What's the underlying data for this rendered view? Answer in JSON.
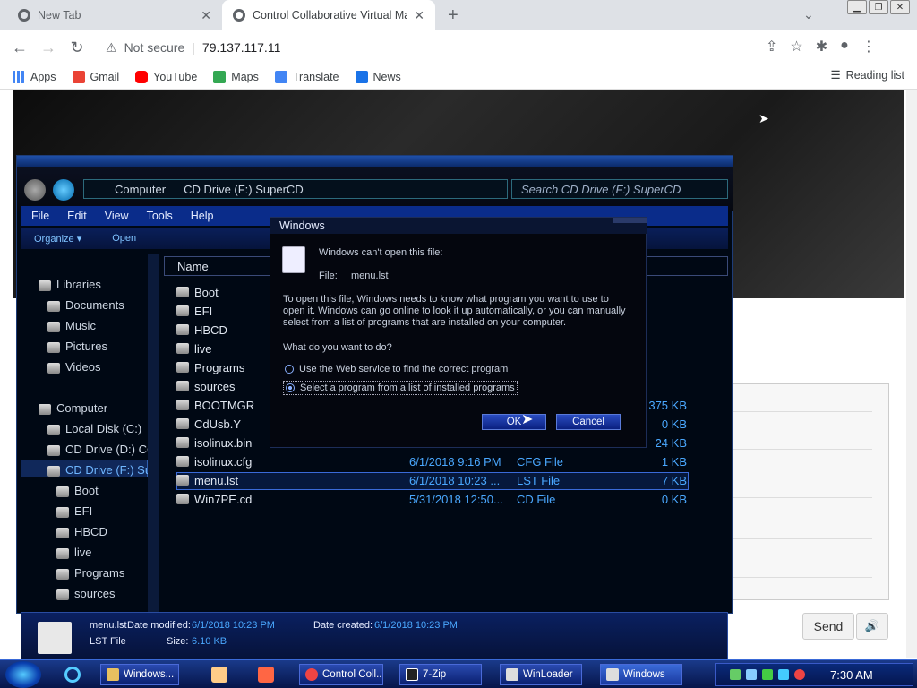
{
  "browser": {
    "tabs": [
      {
        "title": "New Tab",
        "active": false
      },
      {
        "title": "Control Collaborative Virtual Ma",
        "active": true
      }
    ],
    "address": {
      "security": "Not secure",
      "url": "79.137.117.11"
    },
    "bookmarks": [
      {
        "label": "Apps",
        "color": "#4285f4"
      },
      {
        "label": "Gmail",
        "color": "#ea4335"
      },
      {
        "label": "YouTube",
        "color": "#ff0000"
      },
      {
        "label": "Maps",
        "color": "#34a853"
      },
      {
        "label": "Translate",
        "color": "#4285f4"
      },
      {
        "label": "News",
        "color": "#1a73e8"
      }
    ],
    "reading_list": "Reading list"
  },
  "side_panel": {
    "send_label": "Send"
  },
  "explorer": {
    "address": {
      "part1": "Computer",
      "part2": "CD Drive (F:) SuperCD"
    },
    "search_placeholder": "Search CD Drive (F:) SuperCD",
    "menu": [
      "File",
      "Edit",
      "View",
      "Tools",
      "Help"
    ],
    "commands": {
      "organize": "Organize ▾",
      "open": "Open"
    },
    "nav": {
      "libraries": "Libraries",
      "lib_items": [
        "Documents",
        "Music",
        "Pictures",
        "Videos"
      ],
      "computer": "Computer",
      "drives": [
        "Local Disk (C:)",
        "CD Drive (D:) CC",
        "CD Drive (F:) Su"
      ],
      "folders": [
        "Boot",
        "EFI",
        "HBCD",
        "live",
        "Programs",
        "sources"
      ]
    },
    "column_name": "Name",
    "files": [
      {
        "name": "Boot",
        "date": "",
        "type": "",
        "size": ""
      },
      {
        "name": "EFI",
        "date": "",
        "type": "",
        "size": ""
      },
      {
        "name": "HBCD",
        "date": "",
        "type": "",
        "size": ""
      },
      {
        "name": "live",
        "date": "",
        "type": "",
        "size": ""
      },
      {
        "name": "Programs",
        "date": "",
        "type": "",
        "size": ""
      },
      {
        "name": "sources",
        "date": "",
        "type": "",
        "size": ""
      },
      {
        "name": "BOOTMGR",
        "date": "",
        "type": "",
        "size": "375 KB"
      },
      {
        "name": "CdUsb.Y",
        "date": "",
        "type": "",
        "size": "0 KB"
      },
      {
        "name": "isolinux.bin",
        "date": "",
        "type": "",
        "size": "24 KB"
      },
      {
        "name": "isolinux.cfg",
        "date": "6/1/2018 9:16 PM",
        "type": "CFG File",
        "size": "1 KB"
      },
      {
        "name": "menu.lst",
        "date": "6/1/2018 10:23 ...",
        "type": "LST File",
        "size": "7 KB"
      },
      {
        "name": "Win7PE.cd",
        "date": "5/31/2018 12:50...",
        "type": "CD File",
        "size": "0 KB"
      }
    ],
    "details": {
      "filename": "menu.lst",
      "modified_label": "Date modified:",
      "modified": "6/1/2018 10:23 PM",
      "created_label": "Date created:",
      "created": "6/1/2018 10:23 PM",
      "type": "LST File",
      "size_label": "Size:",
      "size": "6.10 KB"
    }
  },
  "dialog": {
    "title": "Windows",
    "cant_open": "Windows can't open this file:",
    "file_label": "File:",
    "file_name": "menu.lst",
    "explain1": "To open this file, Windows needs to know what program you want to use to",
    "explain2": "open it. Windows can go online to look it up automatically, or you can manually",
    "explain3": "select from a list of programs that are installed on your computer.",
    "question": "What do you want to do?",
    "option1": "Use the Web service to find the correct program",
    "option2": "Select a program from a list of installed programs",
    "ok": "OK",
    "cancel": "Cancel"
  },
  "taskbar": {
    "items": [
      "Windows...",
      "Control Coll...",
      "7-Zip",
      "WinLoader",
      "Windows"
    ],
    "clock": "7:30 AM"
  }
}
